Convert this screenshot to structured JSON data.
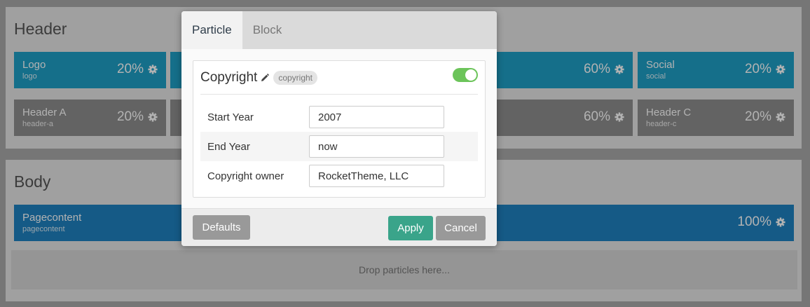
{
  "header_section": {
    "title": "Header",
    "row1": [
      {
        "title": "Logo",
        "sub": "logo",
        "size": "20%"
      },
      {
        "title": "",
        "sub": "",
        "size": "60%"
      },
      {
        "title": "Social",
        "sub": "social",
        "size": "20%"
      }
    ],
    "row2": [
      {
        "title": "Header A",
        "sub": "header-a",
        "size": "20%"
      },
      {
        "title": "",
        "sub": "",
        "size": "60%"
      },
      {
        "title": "Header C",
        "sub": "header-c",
        "size": "20%"
      }
    ]
  },
  "body_section": {
    "title": "Body",
    "particle": {
      "title": "Pagecontent",
      "sub": "pagecontent",
      "size": "100%"
    },
    "dropzone": "Drop particles here..."
  },
  "modal": {
    "tabs": [
      "Particle",
      "Block"
    ],
    "active_tab": "Particle",
    "particle_title": "Copyright",
    "particle_badge": "copyright",
    "enabled": true,
    "fields": [
      {
        "label": "Start Year",
        "value": "2007"
      },
      {
        "label": "End Year",
        "value": "now"
      },
      {
        "label": "Copyright owner",
        "value": "RocketTheme, LLC"
      }
    ],
    "buttons": {
      "defaults": "Defaults",
      "apply": "Apply",
      "cancel": "Cancel"
    }
  },
  "colors": {
    "accent_teal": "#1f9fc6",
    "accent_blue": "#1f82c0",
    "apply_green": "#3aa48a",
    "toggle_green": "#6cc45a"
  },
  "icons": {
    "particle_settings": "gear-icon",
    "edit_title": "pencil-icon"
  }
}
